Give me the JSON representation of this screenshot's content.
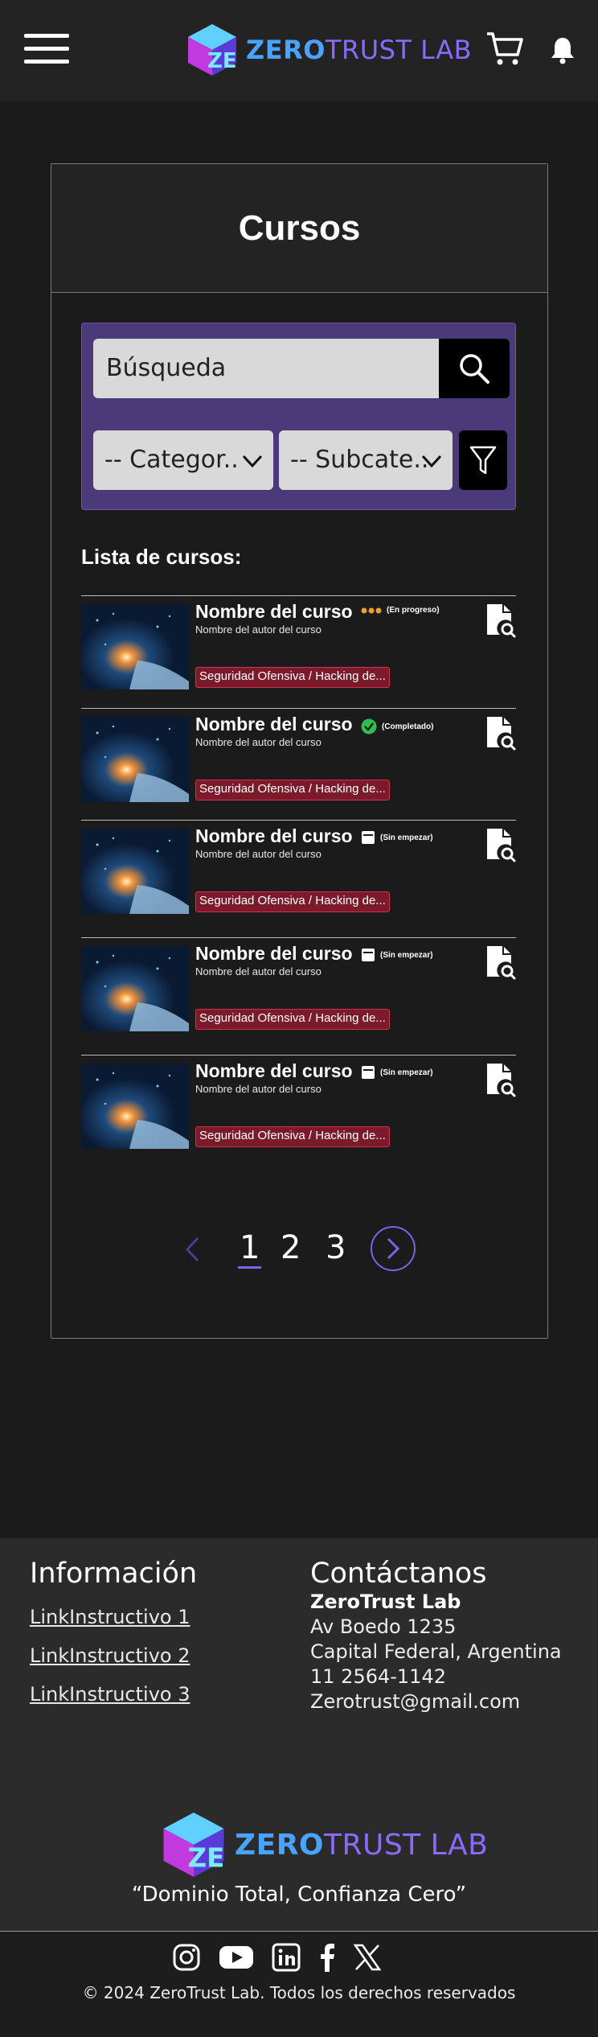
{
  "header": {
    "logo_part1": "ZERO",
    "logo_part2": "TRUST LAB",
    "menu_icon": "hamburger-icon",
    "cart_icon": "cart-icon",
    "bell_icon": "bell-icon"
  },
  "main": {
    "title": "Cursos",
    "search": {
      "placeholder": "Búsqueda"
    },
    "category_select": "-- Categor..",
    "subcategory_select": "-- Subcate..",
    "list_label": "Lista de cursos:",
    "courses": [
      {
        "name": "Nombre del curso",
        "status": "(En progreso)",
        "status_icon": "dots-icon",
        "author": "Nombre del autor del curso",
        "tag": "Seguridad Ofensiva / Hacking de..."
      },
      {
        "name": "Nombre del curso",
        "status": "(Completado)",
        "status_icon": "check-circle-icon",
        "author": "Nombre del autor del curso",
        "tag": "Seguridad Ofensiva / Hacking de..."
      },
      {
        "name": "Nombre del curso",
        "status": "(Sin empezar)",
        "status_icon": "box-icon",
        "author": "Nombre del autor del curso",
        "tag": "Seguridad Ofensiva / Hacking de..."
      },
      {
        "name": "Nombre del curso",
        "status": "(Sin empezar)",
        "status_icon": "box-icon",
        "author": "Nombre del autor del curso",
        "tag": "Seguridad Ofensiva / Hacking de..."
      },
      {
        "name": "Nombre del curso",
        "status": "(Sin empezar)",
        "status_icon": "box-icon",
        "author": "Nombre del autor del curso",
        "tag": "Seguridad Ofensiva / Hacking de..."
      }
    ],
    "pagination": {
      "pages": [
        "1",
        "2",
        "3"
      ],
      "current": "1"
    }
  },
  "footer": {
    "info_heading": "Información",
    "links": [
      "LinkInstructivo 1",
      "LinkInstructivo 2",
      "LinkInstructivo 3"
    ],
    "contact_heading": "Contáctanos",
    "company": "ZeroTrust Lab",
    "address1": "Av Boedo 1235",
    "address2": "Capital Federal, Argentina",
    "phone": "11 2564-1142",
    "email": "Zerotrust@gmail.com",
    "slogan": "“Dominio Total, Confianza Cero”",
    "socials": [
      "instagram-icon",
      "youtube-icon",
      "linkedin-icon",
      "facebook-icon",
      "x-icon"
    ],
    "copyright": "© 2024 ZeroTrust Lab. Todos los derechos reservados"
  },
  "colors": {
    "accent": "#7a63e8",
    "filter_panel": "#4a3a7a",
    "tag_bg": "#7a1a2a",
    "progress": "#f0a030",
    "complete": "#2ebd4e"
  }
}
